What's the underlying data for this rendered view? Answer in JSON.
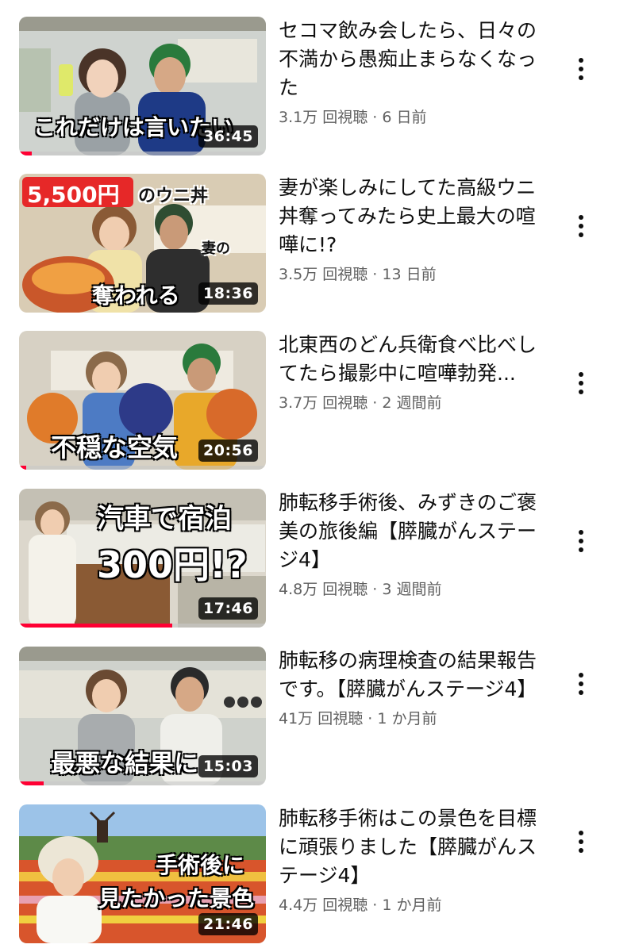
{
  "videos": [
    {
      "title": "セコマ飲み会したら、日々の不満から愚痴止まらなくなった",
      "views": "3.1万 回視聴",
      "age": "6 日前",
      "duration": "36:45",
      "overlay": [
        "これだけは言いたい"
      ],
      "progress": 0.05
    },
    {
      "title": "妻が楽しみにしてた高級ウニ丼奪ってみたら史上最大の喧嘩に!?",
      "views": "3.5万 回視聴",
      "age": "13 日前",
      "duration": "18:36",
      "overlay": [
        "5,500円",
        "のウニ丼",
        "妻の",
        "奪われる"
      ],
      "progress": 0
    },
    {
      "title": "北東西のどん兵衛食べ比べしてたら撮影中に喧嘩勃発...",
      "views": "3.7万 回視聴",
      "age": "2 週間前",
      "duration": "20:56",
      "overlay": [
        "不穏な空気"
      ],
      "progress": 0.03
    },
    {
      "title": "肺転移手術後、みずきのご褒美の旅後編【膵臓がんステージ4】",
      "views": "4.8万 回視聴",
      "age": "3 週間前",
      "duration": "17:46",
      "overlay": [
        "汽車で宿泊",
        "300円!?"
      ],
      "progress": 0.62
    },
    {
      "title": "肺転移の病理検査の結果報告です。【膵臓がんステージ4】",
      "views": "41万 回視聴",
      "age": "1 か月前",
      "duration": "15:03",
      "overlay": [
        "最悪な結果に"
      ],
      "progress": 0.1
    },
    {
      "title": "肺転移手術はこの景色を目標に頑張りました【膵臓がんステージ4】",
      "views": "4.4万 回視聴",
      "age": "1 か月前",
      "duration": "21:46",
      "overlay": [
        "手術後に",
        "見たかった景色"
      ],
      "progress": 0
    }
  ],
  "separator": " · ",
  "icons": {
    "more": "more-vert-icon"
  },
  "colors": {
    "progress": "#ff0033",
    "title": "#0f0f0f",
    "meta": "#606060"
  }
}
